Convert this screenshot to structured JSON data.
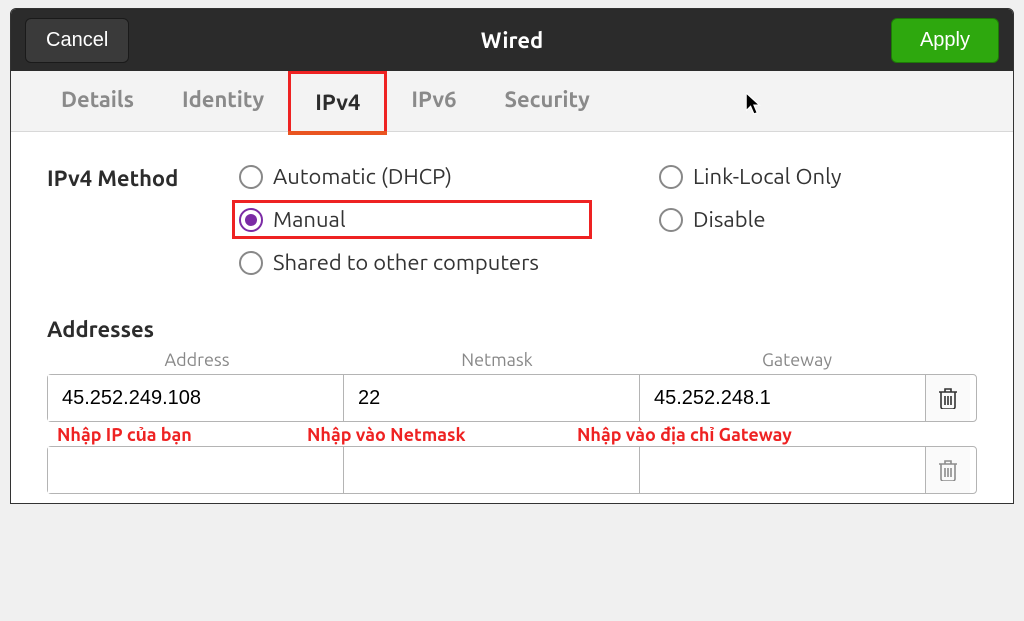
{
  "titlebar": {
    "cancel": "Cancel",
    "title": "Wired",
    "apply": "Apply"
  },
  "tabs": {
    "details": "Details",
    "identity": "Identity",
    "ipv4": "IPv4",
    "ipv6": "IPv6",
    "security": "Security",
    "active": "ipv4"
  },
  "method": {
    "label": "IPv4 Method",
    "options": {
      "automatic_dhcp": "Automatic (DHCP)",
      "manual": "Manual",
      "shared": "Shared to other computers",
      "link_local": "Link-Local Only",
      "disable": "Disable"
    },
    "selected": "manual"
  },
  "addresses": {
    "heading": "Addresses",
    "headers": {
      "address": "Address",
      "netmask": "Netmask",
      "gateway": "Gateway"
    },
    "rows": [
      {
        "address": "45.252.249.108",
        "netmask": "22",
        "gateway": "45.252.248.1"
      },
      {
        "address": "",
        "netmask": "",
        "gateway": ""
      }
    ]
  },
  "annotations": {
    "ip": "Nhập IP của bạn",
    "netmask": "Nhập vào Netmask",
    "gateway": "Nhập vào địa chỉ Gateway"
  }
}
